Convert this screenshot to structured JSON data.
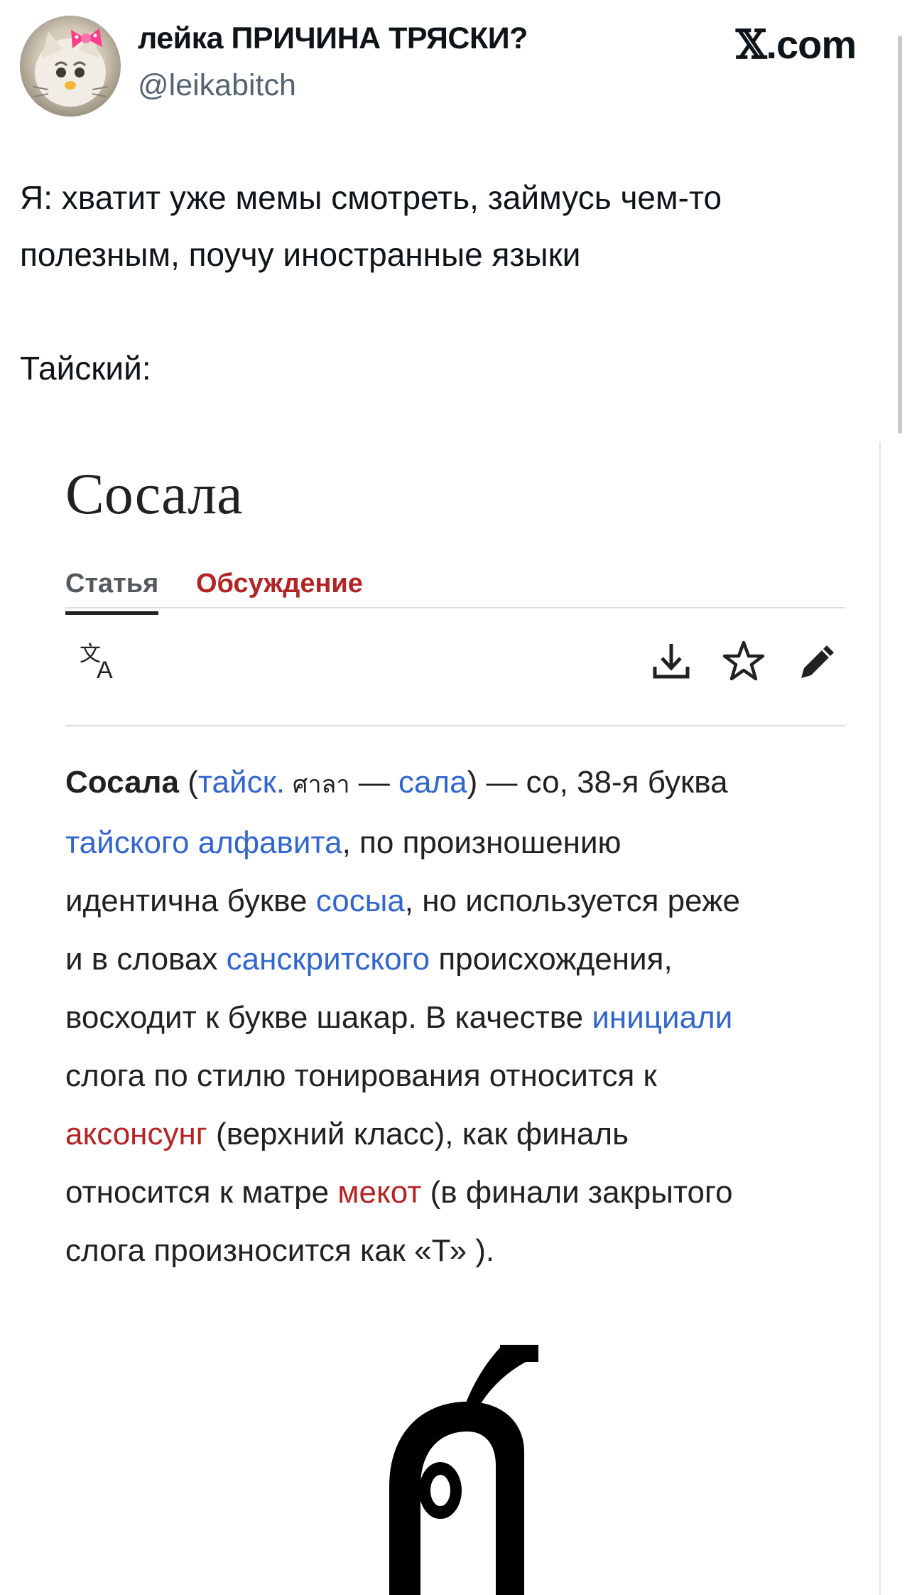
{
  "header": {
    "author_name": "лейка ПРИЧИНА ТРЯСКИ?",
    "author_handle": "@leikabitch",
    "brand_label": ".com",
    "brand_glyph": "𝕏",
    "avatar": "cat-with-pink-bow-avatar"
  },
  "tweet": {
    "paragraph_1": "Я: хватит уже мемы смотреть, займусь чем-то полезным, поучу иностранные языки",
    "paragraph_2": "Тайский:"
  },
  "wiki": {
    "title": "Сосала",
    "tabs": [
      {
        "label": "Статья",
        "active": true
      },
      {
        "label": "Обсуждение",
        "active": false
      }
    ],
    "tools": {
      "translate": "translate-icon",
      "download": "download-icon",
      "watch": "star-icon",
      "edit": "pencil-icon"
    },
    "article": {
      "lead_term": "Сосала",
      "open_paren": " (",
      "lang_link": "тайск.",
      "thai_word": " ศาลา",
      "dash_1": " — ",
      "gloss_link": "сала",
      "after_gloss": ") — со, 38-я буква",
      "alphabet_link": "тайского алфавита",
      "after_alphabet": ", по произношению",
      "line3_text": "идентична букве ",
      "sosya_link": "сосыа",
      "after_sosya": ", но используется реже",
      "line4_text": "и в словах ",
      "sanskrit_link": "санскритского",
      "after_sanskrit": " происхождения,",
      "line5_text": "восходит к букве шакар. В качестве ",
      "initial_link": "инициали",
      "line6_text": "слога по стилю тонирования относится к",
      "akson_link": "аксонсунг",
      "after_akson": " (верхний класс), как финаль",
      "line8_text": "относится к матре ",
      "mekot_link": "мекот",
      "after_mekot": " (в финали закрытого",
      "line9_text": "слога произносится как «Т» )."
    },
    "illustration": "thai-letter-so-sala-glyph",
    "colors": {
      "link": "#3366cc",
      "red_link": "#b32424",
      "text": "#202122",
      "muted": "#54595d"
    }
  }
}
